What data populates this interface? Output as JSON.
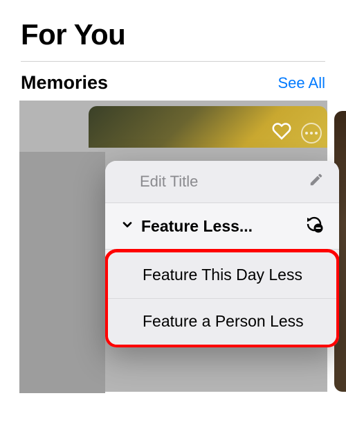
{
  "header": {
    "title": "For You"
  },
  "section": {
    "title": "Memories",
    "see_all": "See All"
  },
  "popup": {
    "edit_title": "Edit Title",
    "feature_less": "Feature Less...",
    "feature_day": "Feature This Day Less",
    "feature_person": "Feature a Person Less"
  }
}
